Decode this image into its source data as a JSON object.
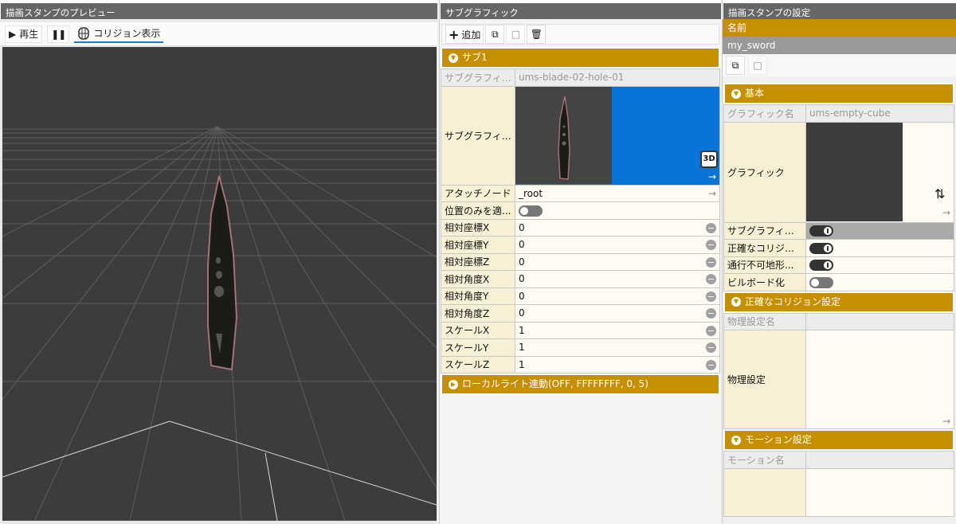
{
  "preview": {
    "title": "描画スタンプのプレビュー",
    "play_label": "再生",
    "collision_label": "コリジョン表示"
  },
  "subgraphic": {
    "title": "サブグラフィック",
    "add_label": "追加",
    "section_label": "サブ1",
    "rows": {
      "name_key": "サブグラフィック名",
      "name_val": "ums-blade-02-hole-01",
      "graphic_key": "サブグラフィック",
      "attach_key": "アタッチノード",
      "attach_val": "_root",
      "posonly_key": "位置のみを適...",
      "px_key": "相対座標X",
      "px_val": "0",
      "py_key": "相対座標Y",
      "py_val": "0",
      "pz_key": "相対座標Z",
      "pz_val": "0",
      "ax_key": "相対角度X",
      "ax_val": "0",
      "ay_key": "相対角度Y",
      "ay_val": "0",
      "az_key": "相対角度Z",
      "az_val": "0",
      "sx_key": "スケールX",
      "sx_val": "1",
      "sy_key": "スケールY",
      "sy_val": "1",
      "sz_key": "スケールZ",
      "sz_val": "1"
    },
    "local_light_label": "ローカルライト連動(OFF, FFFFFFFF, 0, 5)",
    "badge_3d": "3D"
  },
  "settings": {
    "title": "描画スタンプの設定",
    "name_header": "名前",
    "name_value": "my_sword",
    "basic_section": "基本",
    "graphic_name_key": "グラフィック名",
    "graphic_name_val": "ums-empty-cube",
    "graphic_key": "グラフィック",
    "subgraphic_key": "サブグラフィック",
    "exact_collision_key": "正確なコリジョン...",
    "impassable_key": "通行不可地形...",
    "billboard_key": "ビルボード化",
    "exact_collision_section": "正確なコリジョン設定",
    "physics_name_key": "物理設定名",
    "physics_key": "物理設定",
    "motion_section": "モーション設定",
    "motion_name_key": "モーション名"
  },
  "colors": {
    "accent": "#c68f00",
    "selection": "#0a74d6",
    "viewport": "#3c3c3c"
  }
}
